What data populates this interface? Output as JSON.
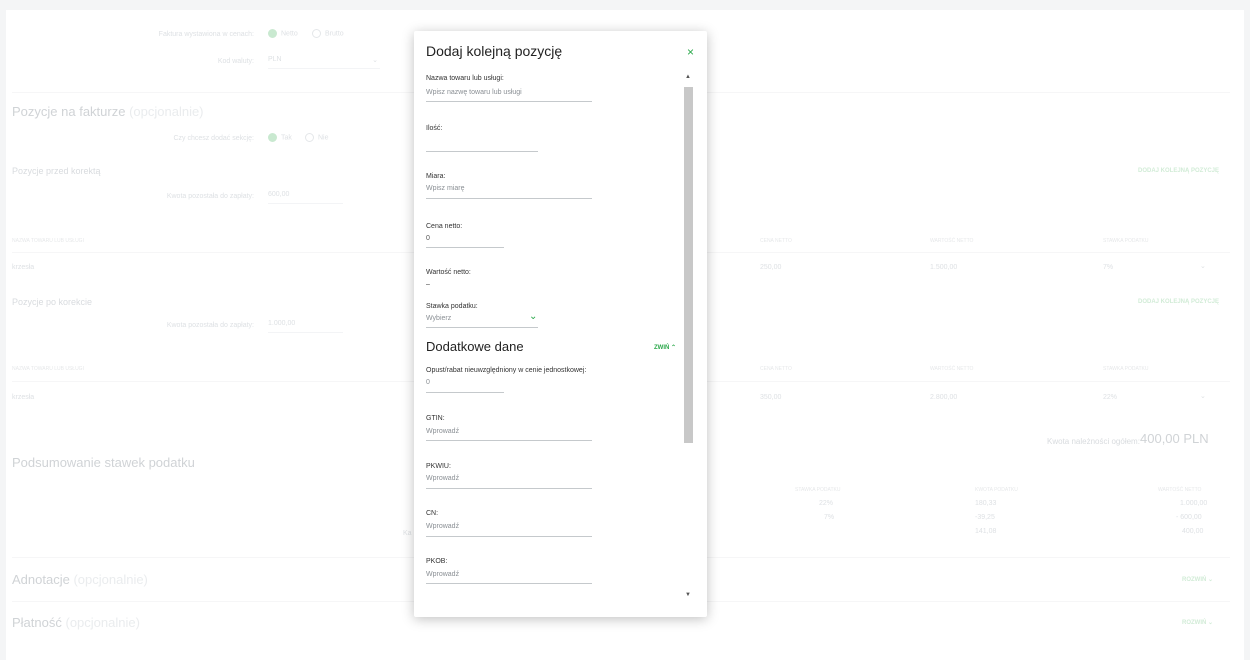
{
  "bg": {
    "invoice_prices_label": "Faktura wystawiona w cenach:",
    "netto": "Netto",
    "brutto": "Brutto",
    "currency_label": "Kod waluty:",
    "currency_value": "PLN",
    "positions_title": "Pozycje na fakturze",
    "optional": "(opcjonalnie)",
    "add_section_label": "Czy chcesz dodać sekcję:",
    "yes": "Tak",
    "no": "Nie",
    "before_title": "Pozycje przed korektą",
    "add_next": "DODAJ KOLEJNĄ POZYCJĘ",
    "remaining_label": "Kwota pozostała do zapłaty:",
    "remaining_before": "600,00",
    "table_headers": [
      "NAZWA TOWARU LUB USŁUGI",
      "CENA NETTO",
      "WARTOŚĆ NETTO",
      "STAWKA PODATKU"
    ],
    "row1": {
      "name": "krzesła",
      "price": "250,00",
      "value": "1.500,00",
      "tax": "7%"
    },
    "after_title": "Pozycje po korekcie",
    "remaining_after": "1.000,00",
    "row2": {
      "name": "krzesła",
      "price": "350,00",
      "value": "2.800,00",
      "tax": "22%"
    },
    "total_label": "Kwota należności ogółem:",
    "total_value": "400,00 PLN",
    "tax_summary_title": "Podsumowanie stawek podatku",
    "summary_headers": [
      "STAWKA PODATKU",
      "KWOTA PODATKU",
      "WARTOŚĆ NETTO"
    ],
    "summary_rows": [
      {
        "rate": "22%",
        "tax": "180,33",
        "net": "1.000,00"
      },
      {
        "rate": "7%",
        "tax": "-39,25",
        "net": "- 600,00"
      },
      {
        "rate": "",
        "tax": "141,08",
        "net": "400,00"
      }
    ],
    "summary_partial": "Ka",
    "annotations_title": "Adnotacje",
    "payment_title": "Płatność",
    "expand": "ROZWIŃ"
  },
  "modal": {
    "title": "Dodaj kolejną pozycję",
    "close_icon": "×",
    "fields": {
      "name_label": "Nazwa towaru lub usługi:",
      "name_placeholder": "Wpisz nazwę towaru lub usługi",
      "qty_label": "Ilość:",
      "unit_label": "Miara:",
      "unit_placeholder": "Wpisz miarę",
      "net_price_label": "Cena netto:",
      "net_price_value": "0",
      "net_value_label": "Wartość netto:",
      "net_value_value": "–",
      "tax_rate_label": "Stawka podatku:",
      "tax_rate_placeholder": "Wybierz"
    },
    "extra_title": "Dodatkowe dane",
    "collapse": "ZWIŃ",
    "extra": {
      "discount_label": "Opust/rabat nieuwzględniony w cenie jednostkowej:",
      "discount_value": "0",
      "gtin_label": "GTIN:",
      "pkwiu_label": "PKWIU:",
      "cn_label": "CN:",
      "pkob_label": "PKOB:",
      "enter_placeholder": "Wprowadź"
    }
  },
  "colors": {
    "accent": "#2aa84a"
  }
}
